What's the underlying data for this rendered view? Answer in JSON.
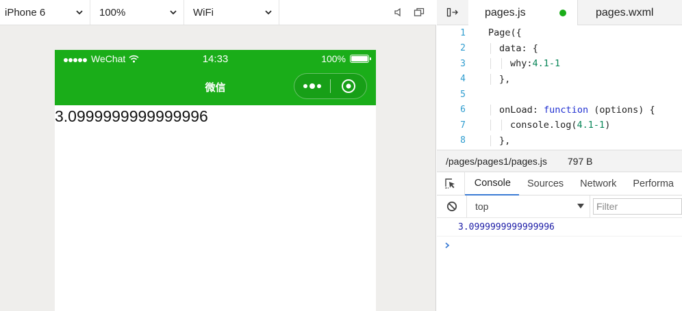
{
  "colors": {
    "wechat_green": "#1aad19",
    "tab_modified_dot": "#1aad19",
    "console_active": "#3a7bd5",
    "log_number": "#1a1aa6"
  },
  "toolbar": {
    "device": "iPhone 6",
    "zoom": "100%",
    "network": "WiFi",
    "icons": [
      "sound-icon",
      "window-icon"
    ]
  },
  "phone": {
    "status_bar": {
      "carrier": "WeChat",
      "time": "14:33",
      "battery": "100%",
      "battery_level": 1.0
    },
    "nav_title": "微信",
    "content": "3.0999999999999996"
  },
  "editor": {
    "tabs": [
      {
        "label": "pages.js",
        "modified": true
      },
      {
        "label": "pages.wxml"
      }
    ],
    "lines": [
      {
        "num": "1"
      },
      {
        "num": "2"
      },
      {
        "num": "3"
      },
      {
        "num": "4"
      },
      {
        "num": "5"
      },
      {
        "num": "6"
      },
      {
        "num": "7"
      },
      {
        "num": "8"
      }
    ],
    "code": {
      "l1": "Page({",
      "l2_key": "data:",
      "l2_rest": " {",
      "l3_key": "why:",
      "l3_val": "4.1-1",
      "l4": "},",
      "l6_key": "onLoad:",
      "l6_fn": "function",
      "l6_rest": " (options) {",
      "l7_a": "console.log(",
      "l7_num": "4.1-1",
      "l7_b": ")",
      "l8": "},"
    }
  },
  "file_info": {
    "path": "/pages/pages1/pages.js",
    "size": "797 B"
  },
  "devtools": {
    "tabs": [
      "Console",
      "Sources",
      "Network",
      "Performa"
    ],
    "context": "top",
    "filter_placeholder": "Filter",
    "log": "3.0999999999999996",
    "prompt": "›"
  }
}
